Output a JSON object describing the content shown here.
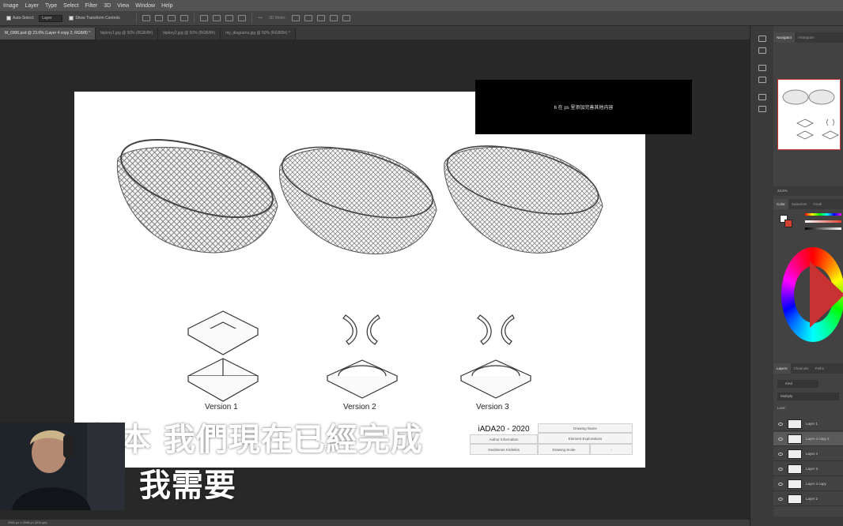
{
  "menu": [
    "Image",
    "Layer",
    "Type",
    "Select",
    "Filter",
    "3D",
    "View",
    "Window",
    "Help"
  ],
  "options": {
    "auto_select_label": "Auto-Select:",
    "auto_select_value": "Layer",
    "transform_controls_label": "Show Transform Controls",
    "more_label": "•••",
    "mode_3d_label": "3D Mode:"
  },
  "tabs": [
    "M_0306.psd @ 23.6% (Layer 4 copy 2, RGB/8) *",
    "biplory1.jpg @ 50% (RGB/8#)",
    "biplory2.jpg @ 50% (RGB/8#)",
    "my_diagrams.jpg @ 50% (RGB/8#) *"
  ],
  "document": {
    "note": "6 在 ps 里添加完善其他内容",
    "versions": [
      "Version 1",
      "Version 2",
      "Version 3"
    ],
    "title_block": {
      "title": "iADA20 - 2020",
      "author": "Author Information",
      "name": "Gediminas Kirdeikis",
      "drawing_name": "Drawing Name",
      "element": "Element Explorations",
      "scale": "Drawing Scale",
      "scale_value": "-"
    }
  },
  "subtitles": {
    "line1": "版本 我們現在已經完成",
    "line2": "了 我需要"
  },
  "status": "3963 px x 2598 px (300 ppi)",
  "panels": {
    "navigator_tabs": [
      "Navigator",
      "Histogram"
    ],
    "zoom_value": "23.6%",
    "color_tabs": [
      "Color",
      "Swatches",
      "Gradi"
    ],
    "layers_tabs": [
      "Layers",
      "Channels",
      "Paths"
    ],
    "kind_label": "Kind",
    "blend_mode": "Multiply",
    "lock_label": "Lock:",
    "layers": [
      "Layer 1",
      "Layer 4 copy 2",
      "Layer 4",
      "Layer 3",
      "Layer 4 copy",
      "Layer 2"
    ],
    "selected_layer_index": 1
  },
  "colors": {
    "accent": "#c83232",
    "ui_dark": "#282828",
    "panel": "#424242"
  }
}
